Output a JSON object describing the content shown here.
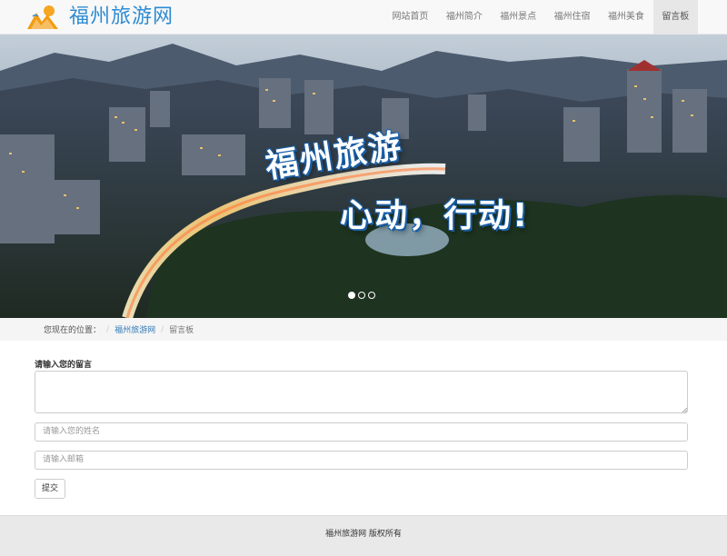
{
  "brand": {
    "title": "福州旅游网",
    "logo_icon": "mountain-sun-logo-icon",
    "color": "#2d8bd3"
  },
  "nav": {
    "items": [
      {
        "label": "网站首页"
      },
      {
        "label": "福州简介"
      },
      {
        "label": "福州景点"
      },
      {
        "label": "福州住宿"
      },
      {
        "label": "福州美食"
      },
      {
        "label": "留言板",
        "active": true
      }
    ]
  },
  "banner": {
    "slogan_line1": "福州旅游",
    "slogan_line2": "心动，行动!",
    "slides": [
      {
        "active": true
      },
      {
        "active": false
      },
      {
        "active": false
      }
    ]
  },
  "breadcrumb": {
    "prefix": "您现在的位置：",
    "sep": "/",
    "link": "福州旅游网",
    "current": "留言板"
  },
  "form": {
    "message_label": "请输入您的留言",
    "message_value": "",
    "name_placeholder": "请输入您的姓名",
    "email_placeholder": "请输入邮箱",
    "submit_label": "提交"
  },
  "footer": {
    "text": "福州旅游网 版权所有"
  }
}
